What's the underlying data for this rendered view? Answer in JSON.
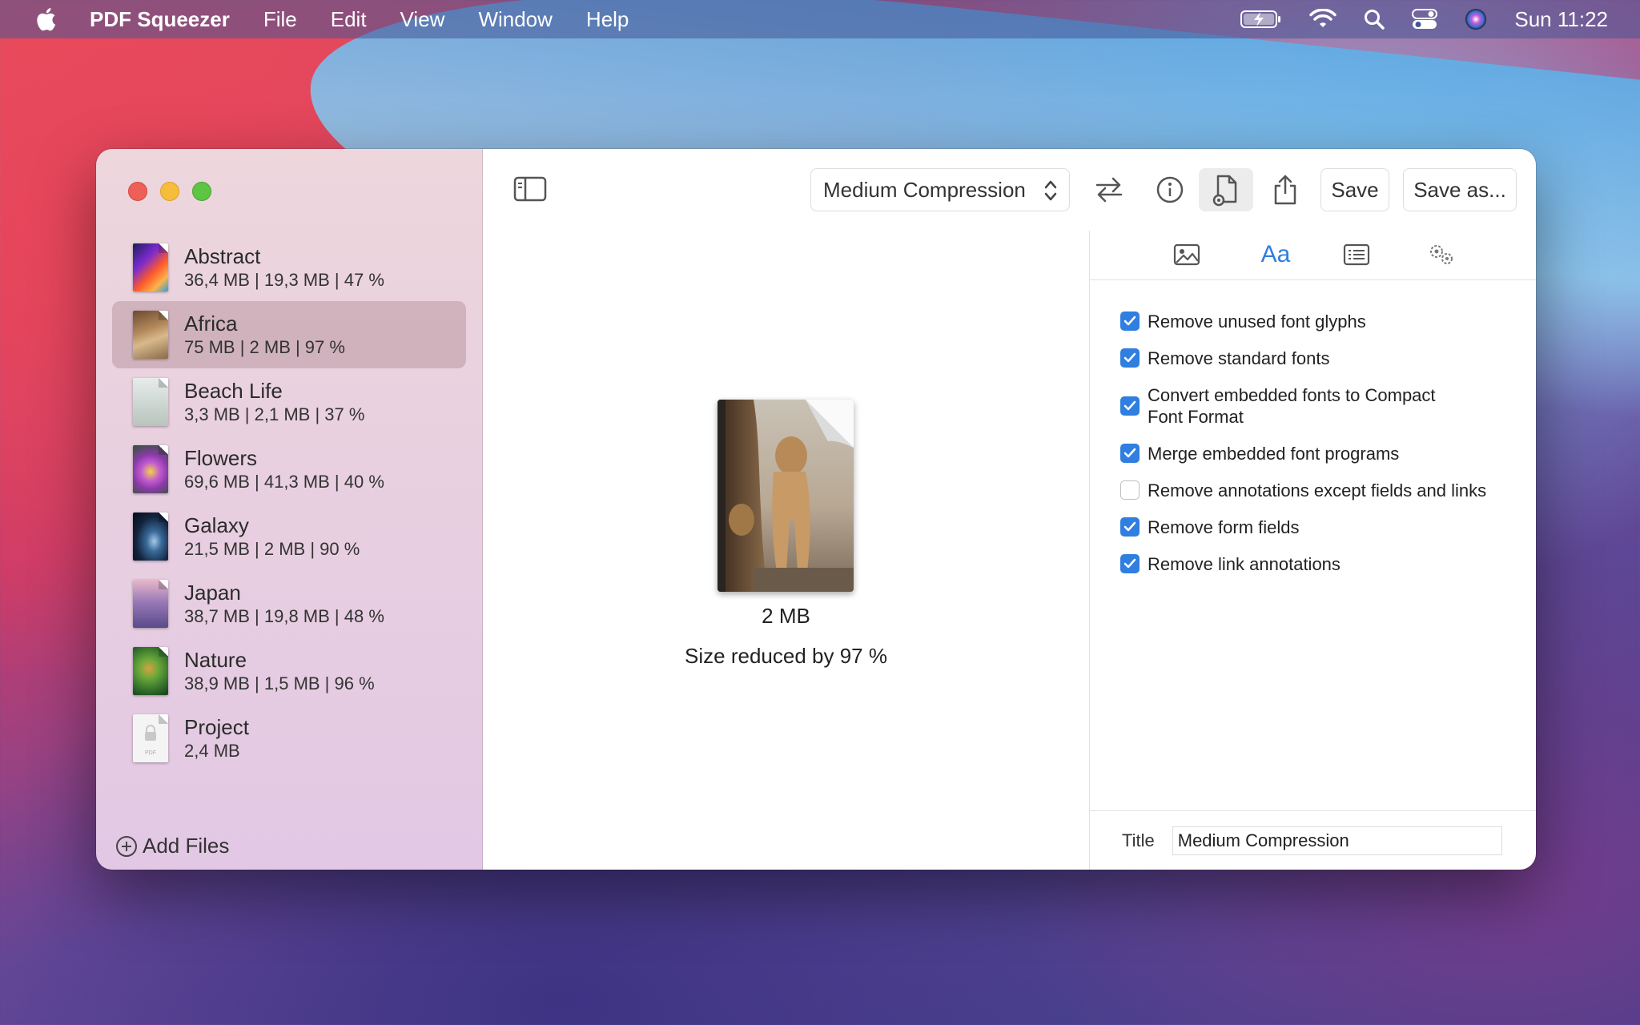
{
  "menubar": {
    "app_name": "PDF Squeezer",
    "items": [
      "File",
      "Edit",
      "View",
      "Window",
      "Help"
    ],
    "clock": "Sun 11:22"
  },
  "sidebar": {
    "files": [
      {
        "name": "Abstract",
        "meta": "36,4 MB | 19,3 MB | 47 %"
      },
      {
        "name": "Africa",
        "meta": "75 MB | 2 MB | 97 %"
      },
      {
        "name": "Beach Life",
        "meta": "3,3 MB | 2,1 MB | 37 %"
      },
      {
        "name": "Flowers",
        "meta": "69,6 MB | 41,3 MB | 40 %"
      },
      {
        "name": "Galaxy",
        "meta": "21,5 MB | 2 MB | 90 %"
      },
      {
        "name": "Japan",
        "meta": "38,7 MB | 19,8 MB | 48 %"
      },
      {
        "name": "Nature",
        "meta": "38,9 MB | 1,5 MB | 96 %"
      },
      {
        "name": "Project",
        "meta": "2,4 MB"
      }
    ],
    "selected_index": 1,
    "add_files_label": "Add Files"
  },
  "toolbar": {
    "compression_preset": "Medium Compression",
    "save_label": "Save",
    "save_as_label": "Save as..."
  },
  "preview": {
    "size": "2 MB",
    "reduction": "Size reduced by 97 %"
  },
  "settings": {
    "tabs": [
      {
        "icon": "image-icon"
      },
      {
        "label": "Aa",
        "icon": "fonts-icon",
        "active": true
      },
      {
        "icon": "list-icon"
      },
      {
        "icon": "gears-icon"
      }
    ],
    "options": [
      {
        "label": "Remove unused font glyphs",
        "checked": true
      },
      {
        "label": "Remove standard fonts",
        "checked": true
      },
      {
        "label": "Convert embedded fonts to Compact Font Format",
        "checked": true
      },
      {
        "label": "Merge embedded font programs",
        "checked": true
      },
      {
        "label": "Remove annotations except fields and links",
        "checked": false
      },
      {
        "label": "Remove form fields",
        "checked": true
      },
      {
        "label": "Remove link annotations",
        "checked": true
      }
    ],
    "title_label": "Title",
    "title_value": "Medium Compression"
  },
  "colors": {
    "accent": "#2f7ee0",
    "close": "#ee5f57",
    "minimize": "#f6bd3b",
    "maximize": "#5ec443"
  }
}
